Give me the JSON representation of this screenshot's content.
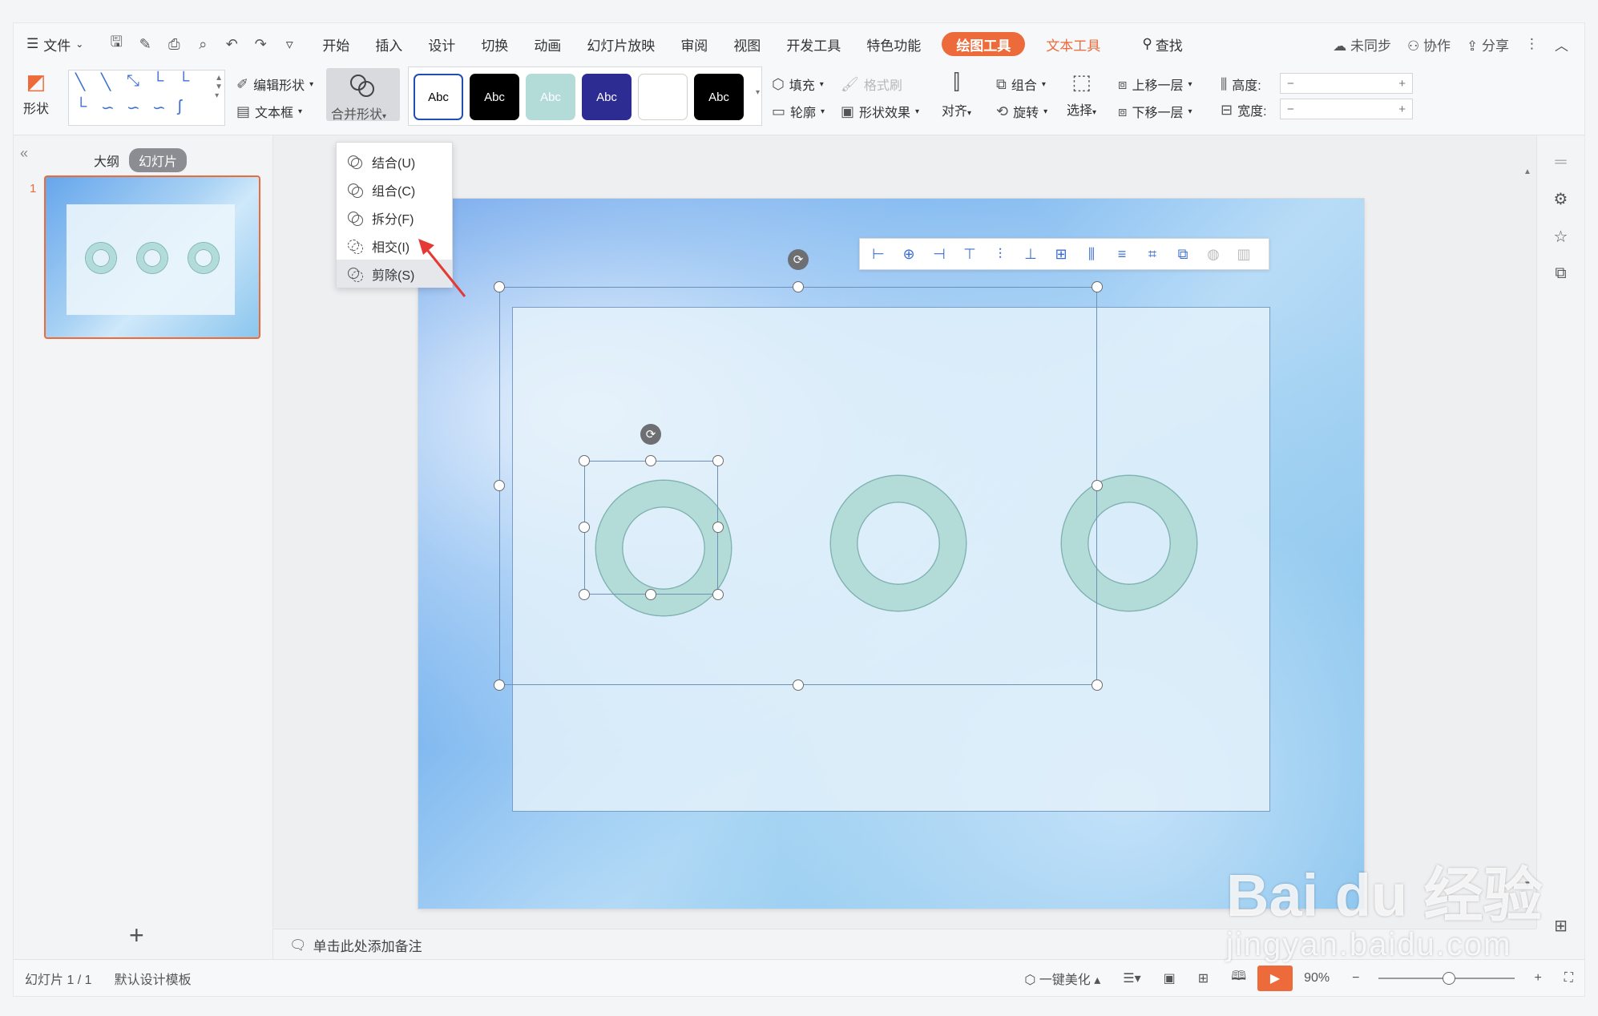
{
  "menu": {
    "file": "文件",
    "tabs": [
      "开始",
      "插入",
      "设计",
      "切换",
      "动画",
      "幻灯片放映",
      "审阅",
      "视图",
      "开发工具",
      "特色功能"
    ],
    "active_tab": "绘图工具",
    "text_tool_tab": "文本工具",
    "search": "查找",
    "sync": "未同步",
    "collab": "协作",
    "share": "分享"
  },
  "ribbon": {
    "shape": "形状",
    "edit_shape": "编辑形状",
    "textbox": "文本框",
    "merge_shape": "合并形状",
    "style_swatches": [
      {
        "label": "Abc",
        "bg": "#ffffff",
        "fg": "#000000",
        "border": "#1f4fb3"
      },
      {
        "label": "Abc",
        "bg": "#000000",
        "fg": "#ffffff",
        "border": "#000000"
      },
      {
        "label": "Abc",
        "bg": "#b3dcd9",
        "fg": "#ffffff",
        "border": "#b3dcd9"
      },
      {
        "label": "Abc",
        "bg": "#2c2c92",
        "fg": "#ffffff",
        "border": "#2c2c92"
      },
      {
        "label": "",
        "bg": "#ffffff",
        "fg": "#000000",
        "border": "#cfcfcf"
      },
      {
        "label": "Abc",
        "bg": "#000000",
        "fg": "#ffffff",
        "border": "#000000"
      }
    ],
    "fill": "填充",
    "format_painter": "格式刷",
    "outline": "轮廓",
    "shape_effect": "形状效果",
    "align": "对齐",
    "group": "组合",
    "rotate": "旋转",
    "select": "选择",
    "bring_forward": "上移一层",
    "send_backward": "下移一层",
    "height_label": "高度:",
    "width_label": "宽度:",
    "minus": "−",
    "plus": "+"
  },
  "merge_menu": {
    "items": [
      "结合(U)",
      "组合(C)",
      "拆分(F)",
      "相交(I)",
      "剪除(S)"
    ],
    "highlighted": "剪除(S)"
  },
  "left_panel": {
    "outline_tab": "大纲",
    "slides_tab": "幻灯片",
    "slide_number": "1",
    "add": "+"
  },
  "notes": {
    "placeholder": "单击此处添加备注"
  },
  "status": {
    "slide_info": "幻灯片 1 / 1",
    "template": "默认设计模板",
    "beautify": "一键美化",
    "zoom": "90%"
  },
  "colors": {
    "accent": "#ed6a3a",
    "ring": "#b3dcd9",
    "ring_outline": "#7fb2b0"
  },
  "watermark": {
    "brand": "Bai du 经验",
    "url": "jingyan.baidu.com"
  }
}
